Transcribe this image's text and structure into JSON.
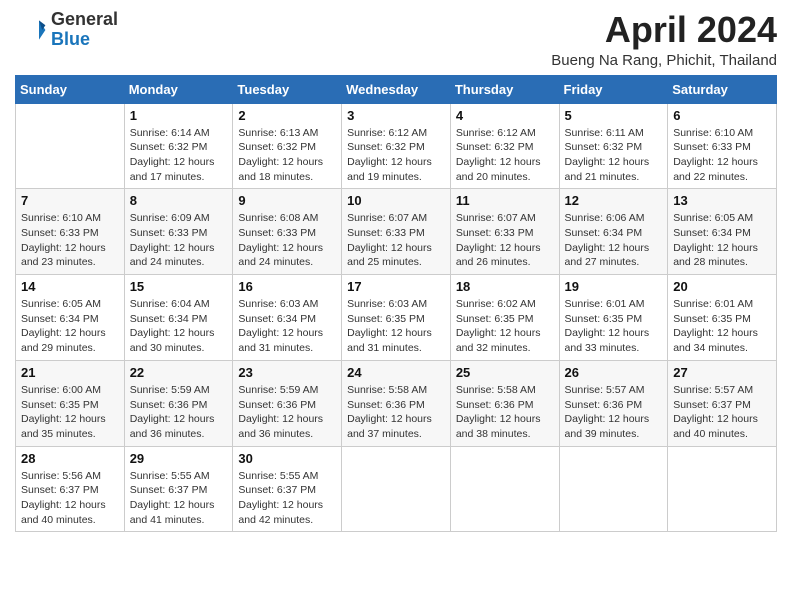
{
  "header": {
    "logo_general": "General",
    "logo_blue": "Blue",
    "month_title": "April 2024",
    "location": "Bueng Na Rang, Phichit, Thailand"
  },
  "weekdays": [
    "Sunday",
    "Monday",
    "Tuesday",
    "Wednesday",
    "Thursday",
    "Friday",
    "Saturday"
  ],
  "weeks": [
    [
      {
        "day": "",
        "sunrise": "",
        "sunset": "",
        "daylight": ""
      },
      {
        "day": "1",
        "sunrise": "Sunrise: 6:14 AM",
        "sunset": "Sunset: 6:32 PM",
        "daylight": "Daylight: 12 hours and 17 minutes."
      },
      {
        "day": "2",
        "sunrise": "Sunrise: 6:13 AM",
        "sunset": "Sunset: 6:32 PM",
        "daylight": "Daylight: 12 hours and 18 minutes."
      },
      {
        "day": "3",
        "sunrise": "Sunrise: 6:12 AM",
        "sunset": "Sunset: 6:32 PM",
        "daylight": "Daylight: 12 hours and 19 minutes."
      },
      {
        "day": "4",
        "sunrise": "Sunrise: 6:12 AM",
        "sunset": "Sunset: 6:32 PM",
        "daylight": "Daylight: 12 hours and 20 minutes."
      },
      {
        "day": "5",
        "sunrise": "Sunrise: 6:11 AM",
        "sunset": "Sunset: 6:32 PM",
        "daylight": "Daylight: 12 hours and 21 minutes."
      },
      {
        "day": "6",
        "sunrise": "Sunrise: 6:10 AM",
        "sunset": "Sunset: 6:33 PM",
        "daylight": "Daylight: 12 hours and 22 minutes."
      }
    ],
    [
      {
        "day": "7",
        "sunrise": "Sunrise: 6:10 AM",
        "sunset": "Sunset: 6:33 PM",
        "daylight": "Daylight: 12 hours and 23 minutes."
      },
      {
        "day": "8",
        "sunrise": "Sunrise: 6:09 AM",
        "sunset": "Sunset: 6:33 PM",
        "daylight": "Daylight: 12 hours and 24 minutes."
      },
      {
        "day": "9",
        "sunrise": "Sunrise: 6:08 AM",
        "sunset": "Sunset: 6:33 PM",
        "daylight": "Daylight: 12 hours and 24 minutes."
      },
      {
        "day": "10",
        "sunrise": "Sunrise: 6:07 AM",
        "sunset": "Sunset: 6:33 PM",
        "daylight": "Daylight: 12 hours and 25 minutes."
      },
      {
        "day": "11",
        "sunrise": "Sunrise: 6:07 AM",
        "sunset": "Sunset: 6:33 PM",
        "daylight": "Daylight: 12 hours and 26 minutes."
      },
      {
        "day": "12",
        "sunrise": "Sunrise: 6:06 AM",
        "sunset": "Sunset: 6:34 PM",
        "daylight": "Daylight: 12 hours and 27 minutes."
      },
      {
        "day": "13",
        "sunrise": "Sunrise: 6:05 AM",
        "sunset": "Sunset: 6:34 PM",
        "daylight": "Daylight: 12 hours and 28 minutes."
      }
    ],
    [
      {
        "day": "14",
        "sunrise": "Sunrise: 6:05 AM",
        "sunset": "Sunset: 6:34 PM",
        "daylight": "Daylight: 12 hours and 29 minutes."
      },
      {
        "day": "15",
        "sunrise": "Sunrise: 6:04 AM",
        "sunset": "Sunset: 6:34 PM",
        "daylight": "Daylight: 12 hours and 30 minutes."
      },
      {
        "day": "16",
        "sunrise": "Sunrise: 6:03 AM",
        "sunset": "Sunset: 6:34 PM",
        "daylight": "Daylight: 12 hours and 31 minutes."
      },
      {
        "day": "17",
        "sunrise": "Sunrise: 6:03 AM",
        "sunset": "Sunset: 6:35 PM",
        "daylight": "Daylight: 12 hours and 31 minutes."
      },
      {
        "day": "18",
        "sunrise": "Sunrise: 6:02 AM",
        "sunset": "Sunset: 6:35 PM",
        "daylight": "Daylight: 12 hours and 32 minutes."
      },
      {
        "day": "19",
        "sunrise": "Sunrise: 6:01 AM",
        "sunset": "Sunset: 6:35 PM",
        "daylight": "Daylight: 12 hours and 33 minutes."
      },
      {
        "day": "20",
        "sunrise": "Sunrise: 6:01 AM",
        "sunset": "Sunset: 6:35 PM",
        "daylight": "Daylight: 12 hours and 34 minutes."
      }
    ],
    [
      {
        "day": "21",
        "sunrise": "Sunrise: 6:00 AM",
        "sunset": "Sunset: 6:35 PM",
        "daylight": "Daylight: 12 hours and 35 minutes."
      },
      {
        "day": "22",
        "sunrise": "Sunrise: 5:59 AM",
        "sunset": "Sunset: 6:36 PM",
        "daylight": "Daylight: 12 hours and 36 minutes."
      },
      {
        "day": "23",
        "sunrise": "Sunrise: 5:59 AM",
        "sunset": "Sunset: 6:36 PM",
        "daylight": "Daylight: 12 hours and 36 minutes."
      },
      {
        "day": "24",
        "sunrise": "Sunrise: 5:58 AM",
        "sunset": "Sunset: 6:36 PM",
        "daylight": "Daylight: 12 hours and 37 minutes."
      },
      {
        "day": "25",
        "sunrise": "Sunrise: 5:58 AM",
        "sunset": "Sunset: 6:36 PM",
        "daylight": "Daylight: 12 hours and 38 minutes."
      },
      {
        "day": "26",
        "sunrise": "Sunrise: 5:57 AM",
        "sunset": "Sunset: 6:36 PM",
        "daylight": "Daylight: 12 hours and 39 minutes."
      },
      {
        "day": "27",
        "sunrise": "Sunrise: 5:57 AM",
        "sunset": "Sunset: 6:37 PM",
        "daylight": "Daylight: 12 hours and 40 minutes."
      }
    ],
    [
      {
        "day": "28",
        "sunrise": "Sunrise: 5:56 AM",
        "sunset": "Sunset: 6:37 PM",
        "daylight": "Daylight: 12 hours and 40 minutes."
      },
      {
        "day": "29",
        "sunrise": "Sunrise: 5:55 AM",
        "sunset": "Sunset: 6:37 PM",
        "daylight": "Daylight: 12 hours and 41 minutes."
      },
      {
        "day": "30",
        "sunrise": "Sunrise: 5:55 AM",
        "sunset": "Sunset: 6:37 PM",
        "daylight": "Daylight: 12 hours and 42 minutes."
      },
      {
        "day": "",
        "sunrise": "",
        "sunset": "",
        "daylight": ""
      },
      {
        "day": "",
        "sunrise": "",
        "sunset": "",
        "daylight": ""
      },
      {
        "day": "",
        "sunrise": "",
        "sunset": "",
        "daylight": ""
      },
      {
        "day": "",
        "sunrise": "",
        "sunset": "",
        "daylight": ""
      }
    ]
  ]
}
